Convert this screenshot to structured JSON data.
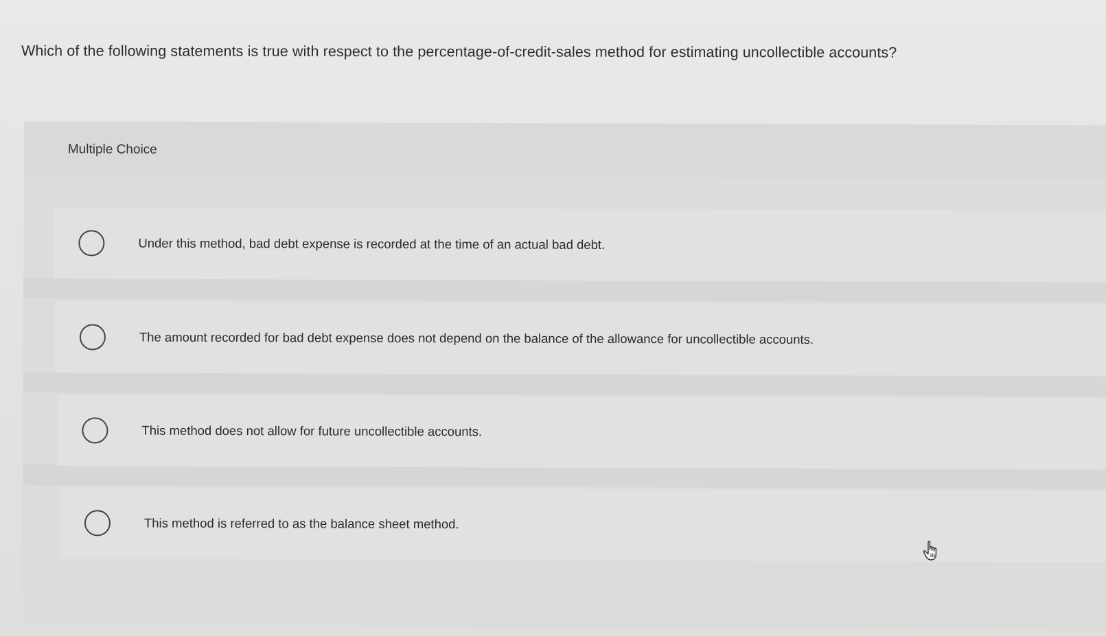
{
  "question": {
    "text": "Which of the following statements is true with respect to the percentage-of-credit-sales method for estimating uncollectible accounts?"
  },
  "multiple_choice": {
    "label": "Multiple Choice",
    "options": [
      {
        "text": "Under this method, bad debt expense is recorded at the time of an actual bad debt."
      },
      {
        "text": "The amount recorded for bad debt expense does not depend on the balance of the allowance for uncollectible accounts."
      },
      {
        "text": "This method does not allow for future uncollectible accounts."
      },
      {
        "text": "This method is referred to as the balance sheet method."
      }
    ]
  },
  "cursor": {
    "icon": "hand-pointer-icon"
  }
}
